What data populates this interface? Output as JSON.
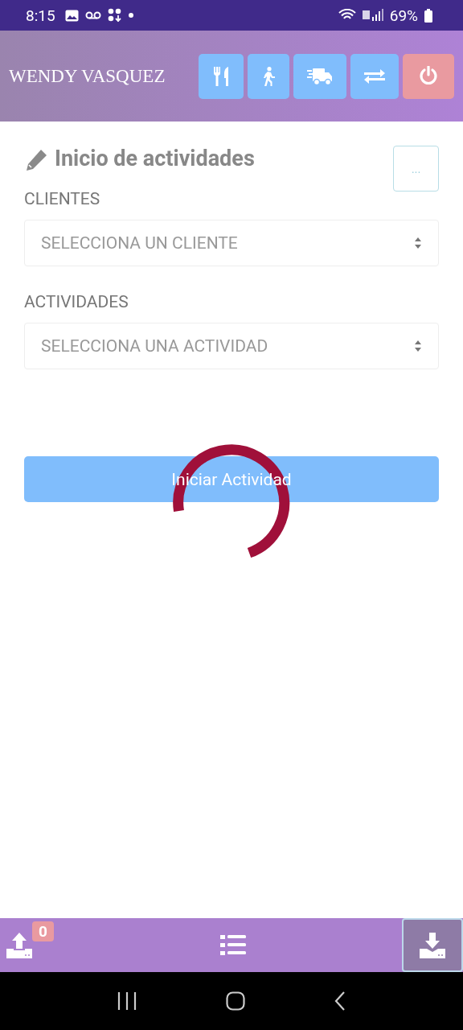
{
  "status_bar": {
    "time": "8:15",
    "battery": "69%"
  },
  "header": {
    "user_name": "WENDY VASQUEZ",
    "buttons": [
      {
        "kind": "utensils"
      },
      {
        "kind": "walk"
      },
      {
        "kind": "truck"
      },
      {
        "kind": "swap"
      },
      {
        "kind": "power"
      }
    ]
  },
  "form": {
    "title": "Inicio de actividades",
    "more_button": "...",
    "fields": [
      {
        "label": "CLIENTES",
        "placeholder": "SELECCIONA UN CLIENTE"
      },
      {
        "label": "ACTIVIDADES",
        "placeholder": "SELECCIONA UNA ACTIVIDAD"
      }
    ],
    "submit_button": "Iniciar Actividad",
    "loading": true
  },
  "bottom_bar": {
    "items": [
      {
        "kind": "upload",
        "badge": "0",
        "selected": false
      },
      {
        "kind": "list",
        "selected": false
      },
      {
        "kind": "download",
        "selected": true
      }
    ]
  }
}
